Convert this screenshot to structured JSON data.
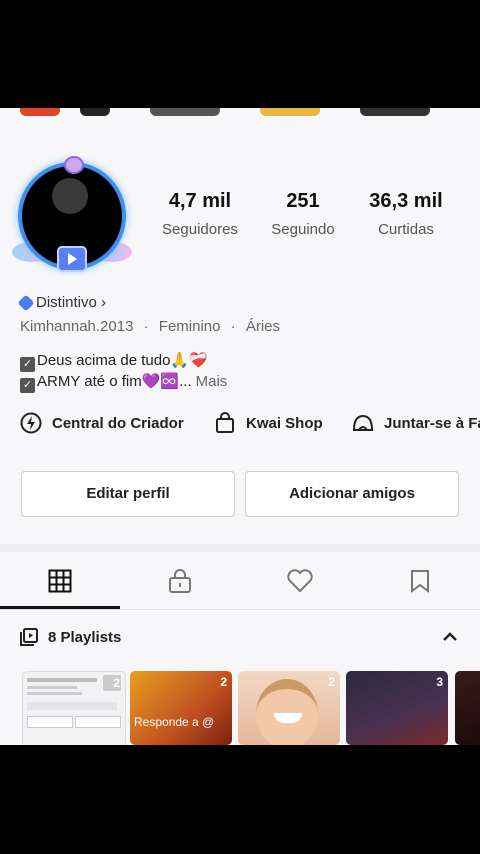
{
  "stats": {
    "followers": {
      "value": "4,7 mil",
      "label": "Seguidores"
    },
    "following": {
      "value": "251",
      "label": "Seguindo"
    },
    "likes": {
      "value": "36,3 mil",
      "label": "Curtidas"
    }
  },
  "badge": {
    "label": "Distintivo ›"
  },
  "info": {
    "username": "Kimhannah.2013",
    "gender": "Feminino",
    "sign": "Áries",
    "sep": "·"
  },
  "bio": {
    "line1": "Deus acima de tudo🙏❤️‍🩹",
    "line2": "ARMY até o fim💜♾️...",
    "more": "Mais"
  },
  "shortcuts": [
    "Central do Criador",
    "Kwai Shop",
    "Juntar-se à Fa"
  ],
  "buttons": {
    "edit": "Editar perfil",
    "add": "Adicionar amigos"
  },
  "tabs": [
    "grid-icon",
    "lock-icon",
    "heart-icon",
    "bookmark-icon"
  ],
  "playlists": {
    "title": "8 Playlists",
    "items": [
      {
        "count": "2",
        "caption": ""
      },
      {
        "count": "2",
        "caption": "Responde a @"
      },
      {
        "count": "2",
        "caption": ""
      },
      {
        "count": "3",
        "caption": ""
      },
      {
        "count": "",
        "caption": ""
      }
    ]
  },
  "colors": {
    "accent": "#3b8ff0",
    "background": "#f7f7f9",
    "text": "#222222"
  }
}
